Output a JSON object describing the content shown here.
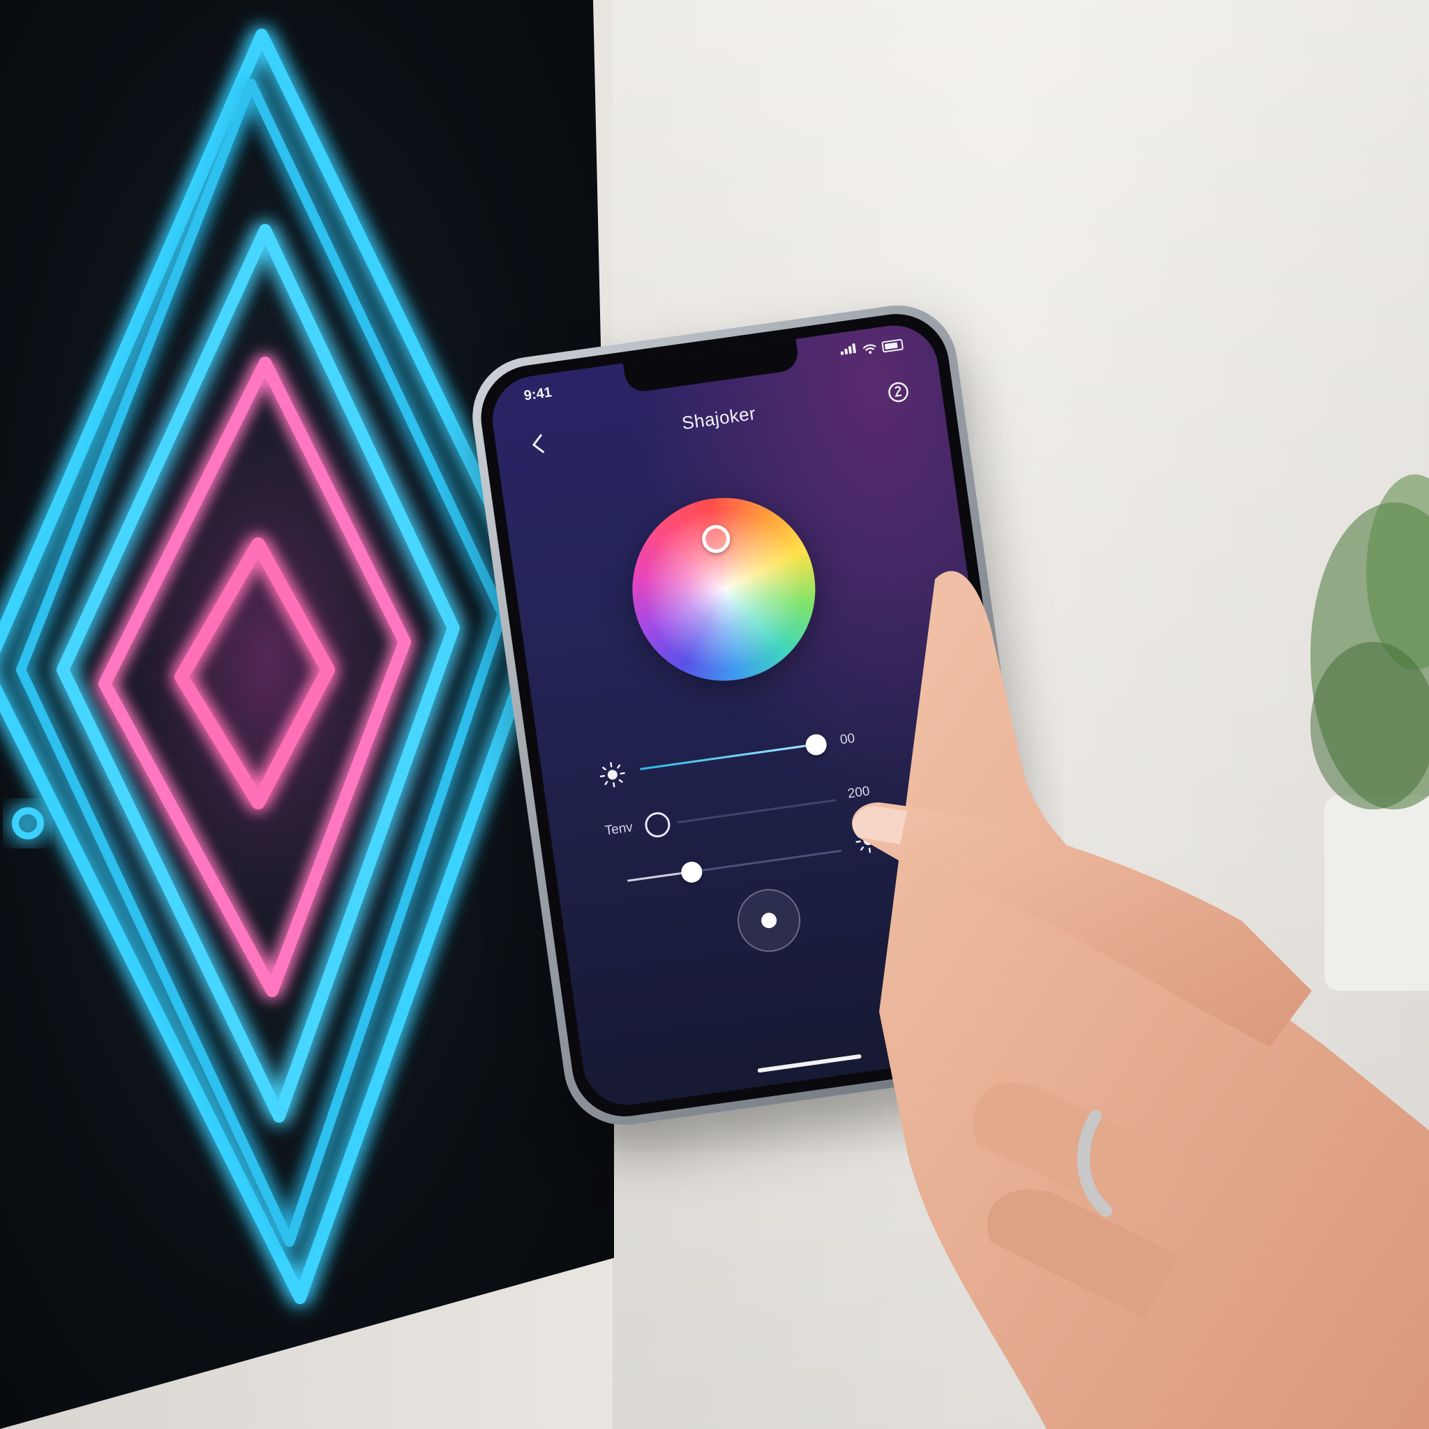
{
  "status_bar": {
    "time": "9:41"
  },
  "header": {
    "title": "Shajoker"
  },
  "icons": {
    "back": "chevron-left-icon",
    "settings": "settings-icon",
    "brightness": "sun-icon",
    "light": "sun-icon",
    "power": "power-icon"
  },
  "sliders": {
    "brightness": {
      "value_label": "00",
      "level": 0.98
    },
    "temperature": {
      "label": "Tenv",
      "value_label": "200",
      "level": 0.0
    },
    "intensity": {
      "level": 0.3
    }
  },
  "colors": {
    "accent": "#2ab7e8",
    "screen_top": "#2a2466",
    "screen_bottom": "#171a33",
    "neon_blue": "#3ad2ff",
    "neon_pink": "#ff6fb8"
  }
}
